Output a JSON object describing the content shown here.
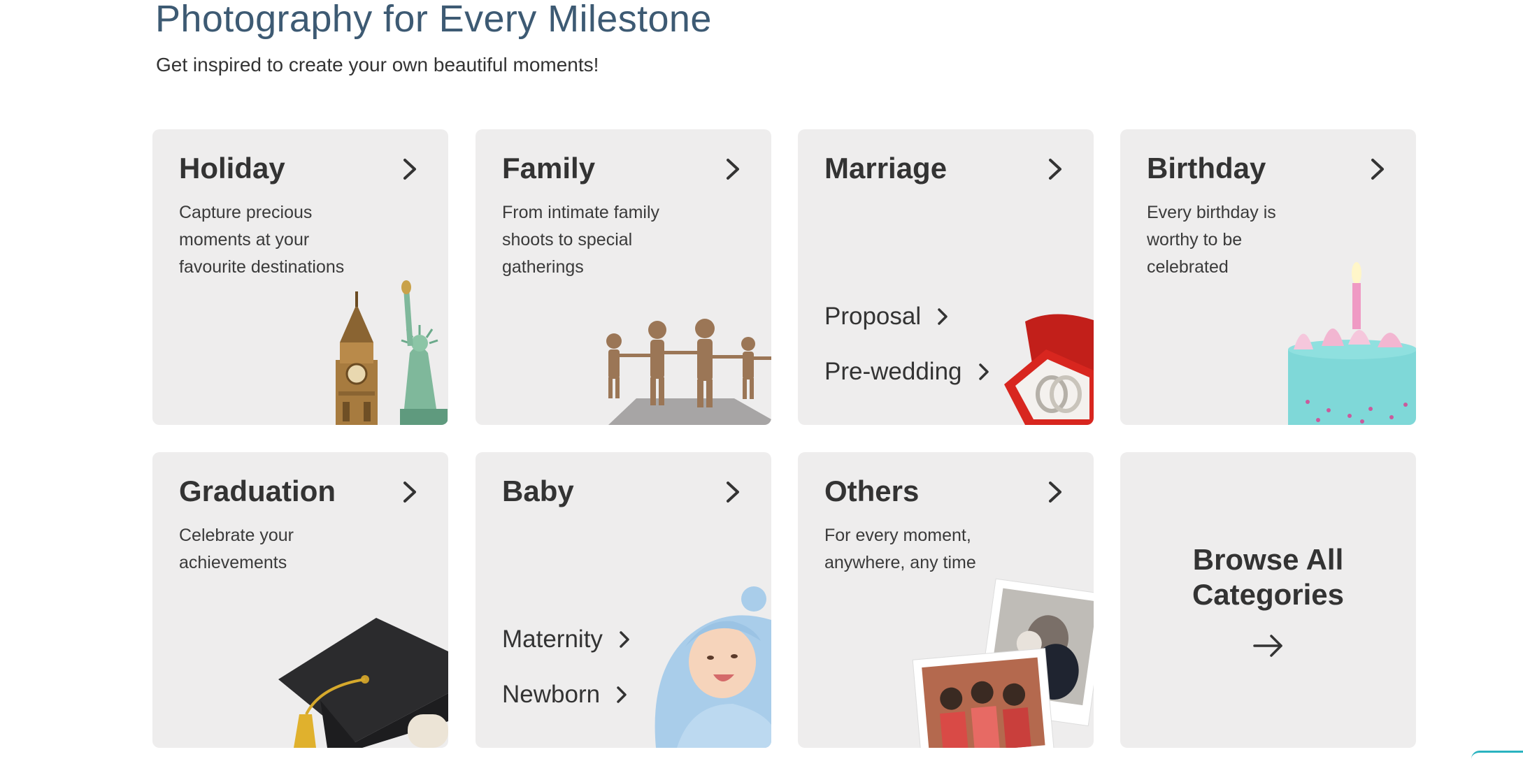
{
  "page": {
    "title": "Photography for Every Milestone",
    "subtitle": "Get inspired to create your own beautiful moments!"
  },
  "cards": {
    "holiday": {
      "title": "Holiday",
      "desc": "Capture precious moments at your favourite destinations"
    },
    "family": {
      "title": "Family",
      "desc": "From intimate family shoots to special gatherings"
    },
    "marriage": {
      "title": "Marriage",
      "links": [
        "Proposal",
        "Pre-wedding"
      ]
    },
    "birthday": {
      "title": "Birthday",
      "desc": "Every birthday is worthy to be celebrated"
    },
    "graduation": {
      "title": "Graduation",
      "desc": "Celebrate your achievements"
    },
    "baby": {
      "title": "Baby",
      "links": [
        "Maternity",
        "Newborn"
      ]
    },
    "others": {
      "title": "Others",
      "desc": "For every moment, anywhere, any time"
    },
    "browse": {
      "label": "Browse All Categories"
    }
  },
  "colors": {
    "title": "#3d5a73",
    "card_bg": "#eeeded",
    "text": "#333333",
    "accent": "#2bb3c0"
  }
}
